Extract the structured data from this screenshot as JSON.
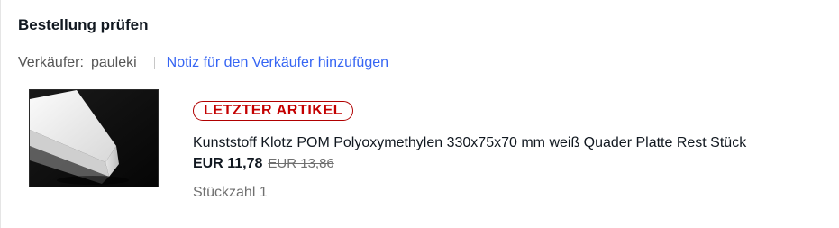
{
  "section": {
    "title": "Bestellung prüfen"
  },
  "seller": {
    "label": "Verkäufer:",
    "name": "pauleki",
    "note_link": "Notiz für den Verkäufer hinzufügen"
  },
  "item": {
    "badge": "LETZTER ARTIKEL",
    "title": "Kunststoff Klotz POM Polyoxymethylen 330x75x70 mm weiß Quader Platte Rest Stück",
    "price": "EUR 11,78",
    "original_price": "EUR 13,86",
    "quantity": "Stückzahl 1",
    "image_icon": "white-plastic-block-photo"
  },
  "colors": {
    "badge": "#c40000",
    "link": "#3665f3",
    "muted": "#707070"
  }
}
